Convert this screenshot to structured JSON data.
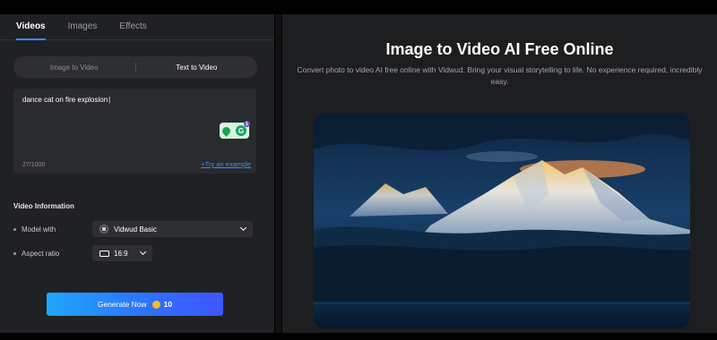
{
  "tabs": [
    {
      "label": "Videos",
      "active": true
    },
    {
      "label": "Images",
      "active": false
    },
    {
      "label": "Effects",
      "active": false
    }
  ],
  "mode_toggle": {
    "image_to_video": "Image to Video",
    "text_to_video": "Text to Video",
    "selected": "Text to Video"
  },
  "prompt": {
    "value": "dance cat on fire explosion",
    "char_count": "27/1000",
    "try_example": "+Try an example"
  },
  "video_info": {
    "title": "Video Information",
    "model_label": "Model with",
    "model_value": "Vidwud Basic",
    "aspect_label": "Aspect ratio",
    "aspect_value": "16:9"
  },
  "generate": {
    "label": "Generate Now",
    "credits": "10"
  },
  "extension": {
    "badge_count": "1"
  },
  "hero": {
    "title": "Image to Video AI Free Online",
    "subtitle": "Convert photo to video AI free online with Vidwud. Bring your visual storytelling to life. No experience required, incredibly easy."
  },
  "colors": {
    "accent": "#3d8bff",
    "panel_left": "#202124",
    "panel_right": "#1d1e20",
    "coin": "#f5c020"
  }
}
